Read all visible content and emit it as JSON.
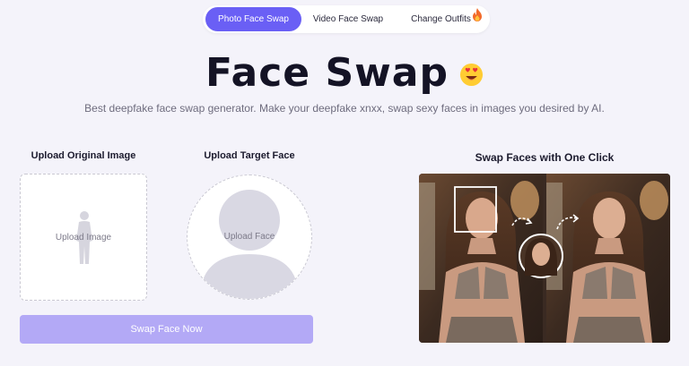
{
  "tabs": [
    {
      "label": "Photo Face Swap",
      "active": true
    },
    {
      "label": "Video Face Swap",
      "active": false
    },
    {
      "label": "Change Outfits",
      "active": false,
      "badge_icon": "fire-icon"
    }
  ],
  "header": {
    "title": "Face Swap",
    "title_icon": "heart-eyes-emoji-icon",
    "subtitle": "Best deepfake face swap generator. Make your deepfake xnxx, swap sexy faces in images you desired by AI."
  },
  "upload": {
    "original_label": "Upload Original Image",
    "original_placeholder": "Upload Image",
    "target_label": "Upload Target Face",
    "target_placeholder": "Upload Face"
  },
  "action": {
    "swap_button": "Swap Face Now"
  },
  "demo": {
    "title": "Swap Faces with One Click"
  },
  "colors": {
    "accent": "#6a5ff5",
    "button_disabled": "#b3a9f6",
    "background": "#f4f3fa"
  }
}
